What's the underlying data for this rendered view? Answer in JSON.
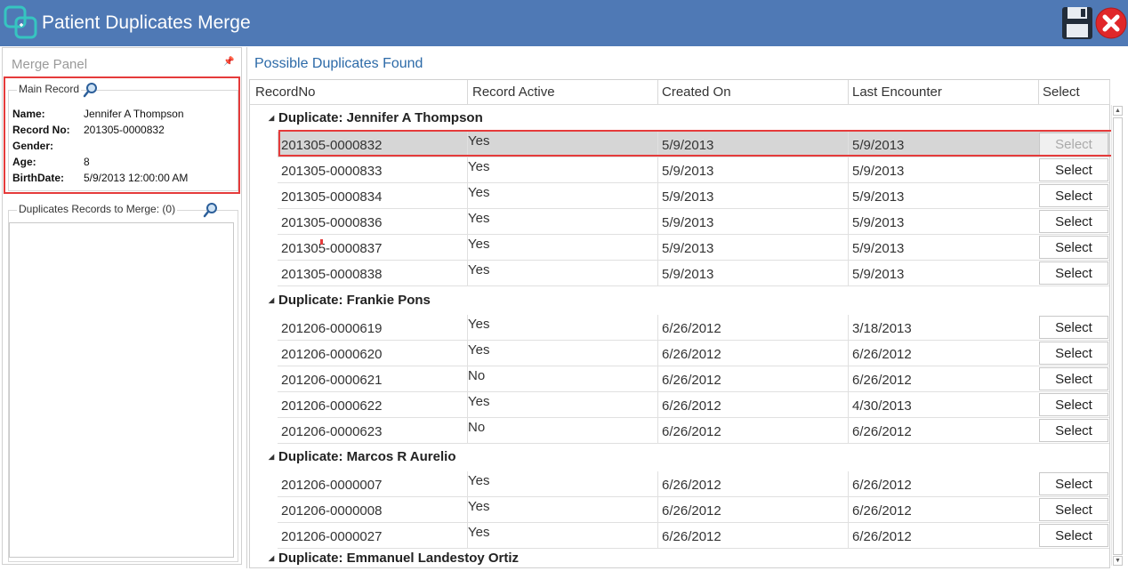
{
  "window": {
    "title": "Patient Duplicates Merge"
  },
  "merge_panel": {
    "title": "Merge Panel",
    "main_record": {
      "label": "Main Record",
      "fields": [
        {
          "label": "Name:",
          "value": "Jennifer A Thompson"
        },
        {
          "label": "Record No:",
          "value": "201305-0000832"
        },
        {
          "label": "Gender:",
          "value": ""
        },
        {
          "label": "Age:",
          "value": "8"
        },
        {
          "label": "BirthDate:",
          "value": "5/9/2013 12:00:00 AM"
        }
      ]
    },
    "duplicates_label": "Duplicates Records to Merge: (0)"
  },
  "duplicates": {
    "title": "Possible Duplicates Found",
    "columns": [
      "RecordNo",
      "Record Active",
      "Created On",
      "Last Encounter",
      "Select"
    ],
    "groups": [
      {
        "label": "Duplicate: Jennifer A Thompson",
        "rows": [
          {
            "record_no": "201305-0000832",
            "active": "Yes",
            "created": "5/9/2013",
            "last": "5/9/2013",
            "select": "Select"
          },
          {
            "record_no": "201305-0000833",
            "active": "Yes",
            "created": "5/9/2013",
            "last": "5/9/2013",
            "select": "Select"
          },
          {
            "record_no": "201305-0000834",
            "active": "Yes",
            "created": "5/9/2013",
            "last": "5/9/2013",
            "select": "Select"
          },
          {
            "record_no": "201305-0000836",
            "active": "Yes",
            "created": "5/9/2013",
            "last": "5/9/2013",
            "select": "Select"
          },
          {
            "record_no": "201305-0000837",
            "active": "Yes",
            "created": "5/9/2013",
            "last": "5/9/2013",
            "select": "Select"
          },
          {
            "record_no": "201305-0000838",
            "active": "Yes",
            "created": "5/9/2013",
            "last": "5/9/2013",
            "select": "Select"
          }
        ]
      },
      {
        "label": "Duplicate: Frankie Pons",
        "rows": [
          {
            "record_no": "201206-0000619",
            "active": "Yes",
            "created": "6/26/2012",
            "last": "3/18/2013",
            "select": "Select"
          },
          {
            "record_no": "201206-0000620",
            "active": "Yes",
            "created": "6/26/2012",
            "last": "6/26/2012",
            "select": "Select"
          },
          {
            "record_no": "201206-0000621",
            "active": "No",
            "created": "6/26/2012",
            "last": "6/26/2012",
            "select": "Select"
          },
          {
            "record_no": "201206-0000622",
            "active": "Yes",
            "created": "6/26/2012",
            "last": "4/30/2013",
            "select": "Select"
          },
          {
            "record_no": "201206-0000623",
            "active": "No",
            "created": "6/26/2012",
            "last": "6/26/2012",
            "select": "Select"
          }
        ]
      },
      {
        "label": "Duplicate: Marcos R Aurelio",
        "rows": [
          {
            "record_no": "201206-0000007",
            "active": "Yes",
            "created": "6/26/2012",
            "last": "6/26/2012",
            "select": "Select"
          },
          {
            "record_no": "201206-0000008",
            "active": "Yes",
            "created": "6/26/2012",
            "last": "6/26/2012",
            "select": "Select"
          },
          {
            "record_no": "201206-0000027",
            "active": "Yes",
            "created": "6/26/2012",
            "last": "6/26/2012",
            "select": "Select"
          }
        ]
      },
      {
        "label": "Duplicate: Emmanuel Landestoy Ortiz",
        "rows": []
      }
    ]
  },
  "colors": {
    "titlebar": "#4f79b5",
    "highlight": "#e53b3b",
    "link": "#2c6aa8"
  }
}
